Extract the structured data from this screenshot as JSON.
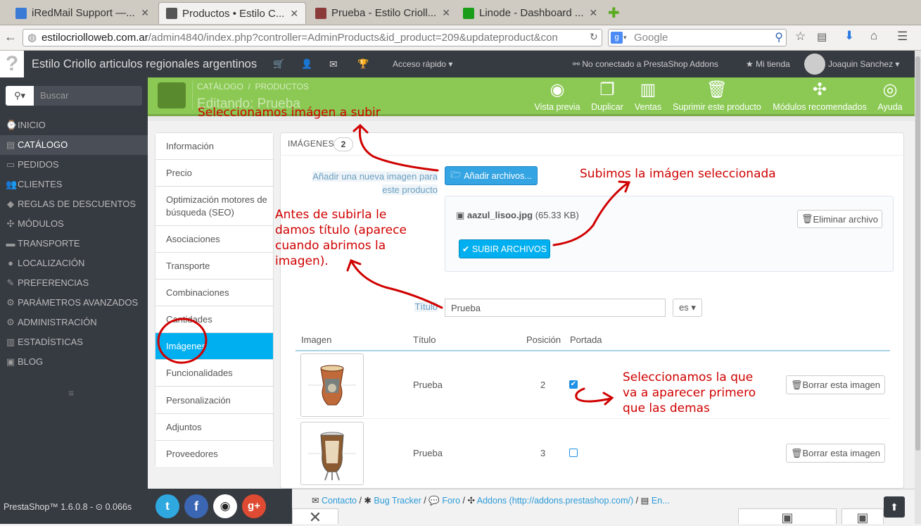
{
  "browser": {
    "tabs": [
      {
        "label": "iRedMail Support —...",
        "color": "#3a7bd5"
      },
      {
        "label": "Productos • Estilo C...",
        "color": "#555555"
      },
      {
        "label": "Prueba - Estilo Crioll...",
        "color": "#8b3a3a"
      },
      {
        "label": "Linode - Dashboard ...",
        "color": "#1a9e1a"
      }
    ],
    "new_tab": "✚",
    "url_host": "estilocriolloweb.com.ar",
    "url_path": "/admin4840/index.php?controller=AdminProducts&id_product=209&updateproduct&con",
    "search_placeholder": "Google"
  },
  "topbar": {
    "help": "?",
    "shop_name": "Estilo Criollo articulos regionales argentinos",
    "quick_access": "Acceso rápido ▾",
    "addons": "No conectado a PrestaShop Addons",
    "my_shop": "Mi tienda",
    "user": "Joaquin Sanchez ▾"
  },
  "sidebar": {
    "search_placeholder": "Buscar",
    "items": [
      {
        "label": "INICIO",
        "icon": "⌚"
      },
      {
        "label": "CATÁLOGO",
        "icon": "▤"
      },
      {
        "label": "PEDIDOS",
        "icon": "▭"
      },
      {
        "label": "CLIENTES",
        "icon": "👥"
      },
      {
        "label": "REGLAS DE DESCUENTOS",
        "icon": "◆"
      },
      {
        "label": "MÓDULOS",
        "icon": "✣"
      },
      {
        "label": "TRANSPORTE",
        "icon": "▬"
      },
      {
        "label": "LOCALIZACIÓN",
        "icon": "●"
      },
      {
        "label": "PREFERENCIAS",
        "icon": "✎"
      },
      {
        "label": "PARÁMETROS AVANZADOS",
        "icon": "⚙"
      },
      {
        "label": "ADMINISTRACIÓN",
        "icon": "⚙"
      },
      {
        "label": "ESTADÍSTICAS",
        "icon": "▥"
      },
      {
        "label": "BLOG",
        "icon": "▣"
      }
    ],
    "collapse": "≡"
  },
  "header": {
    "breadcrumb_1": "CATÁLOGO",
    "breadcrumb_sep": "/",
    "breadcrumb_2": "PRODUCTOS",
    "title": "Editando: Prueba",
    "buttons": [
      {
        "label": "Vista previa",
        "icon": "◉"
      },
      {
        "label": "Duplicar",
        "icon": "❐"
      },
      {
        "label": "Ventas",
        "icon": "▥"
      },
      {
        "label": "Suprimir este producto",
        "icon": "🗑"
      },
      {
        "label": "Módulos recomendados",
        "icon": "✣"
      },
      {
        "label": "Ayuda",
        "icon": "◎"
      }
    ]
  },
  "product_tabs": [
    "Información",
    "Precio",
    "Optimización motores de búsqueda (SEO)",
    "Asociaciones",
    "Transporte",
    "Combinaciones",
    "Cantidades",
    "Imágenes",
    "Funcionalidades",
    "Personalización",
    "Adjuntos",
    "Proveedores"
  ],
  "images_panel": {
    "heading": "IMÁGENES",
    "count": "2",
    "add_label": "Añadir una nueva imagen para este producto",
    "add_button": "Añadir archivos...",
    "file_name": "aazul_lisoo.jpg",
    "file_size": "(65.33 KB)",
    "delete_file": "Eliminar archivo",
    "upload_button": "SUBIR ARCHIVOS",
    "title_label": "Título",
    "title_value": "Prueba",
    "lang": "es ▾",
    "columns": [
      "Imagen",
      "Título",
      "Posición",
      "Portada"
    ],
    "rows": [
      {
        "title": "Prueba",
        "position": "2",
        "cover": true,
        "delete": "Borrar esta imagen"
      },
      {
        "title": "Prueba",
        "position": "3",
        "cover": false,
        "delete": "Borrar esta imagen"
      }
    ]
  },
  "annotations": {
    "a1": "Seleccionamos imágen a subir",
    "a2": "Subimos la imágen seleccionada",
    "a3_1": "Antes de subirla le",
    "a3_2": "damos título (aparece",
    "a3_3": "cuando abrimos la",
    "a3_4": "imagen).",
    "a4_1": "Seleccionamos la que",
    "a4_2": "va a aparecer primero",
    "a4_3": "que las demas",
    "color": "#d00000"
  },
  "footer": {
    "version": "PrestaShop™ 1.6.0.8 - ",
    "time": "0.066s",
    "links": [
      "Contacto",
      "Bug Tracker",
      "Foro",
      "Addons (http://addons.prestashop.com/)",
      "En..."
    ],
    "sep": "/",
    "social": [
      "twitter-icon",
      "facebook-icon",
      "github-icon",
      "google-plus-icon"
    ],
    "social_glyphs": [
      "t",
      "f",
      "◉",
      "g+"
    ]
  }
}
